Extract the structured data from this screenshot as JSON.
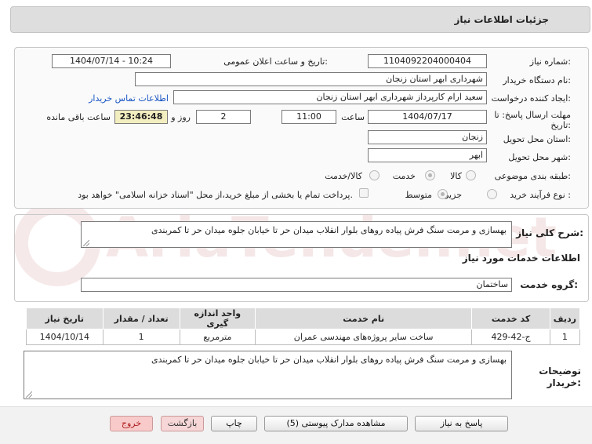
{
  "header": {
    "title": "جزئیات اطلاعات نیاز"
  },
  "fields": {
    "need_number": {
      "label": "شماره نیاز:",
      "value": "1104092204000404"
    },
    "announce_datetime": {
      "label": "تاریخ و ساعت اعلان عمومی:",
      "value": "1404/07/14 - 10:24"
    },
    "buyer_org": {
      "label": "نام دستگاه خریدار:",
      "value": "شهرداری ابهر استان زنجان"
    },
    "creator": {
      "label": "ایجاد کننده درخواست:",
      "value": "سعید ارام کارپرداز  شهرداری ابهر استان زنجان"
    },
    "contact_link": "اطلاعات تماس خریدار",
    "deadline": {
      "label": "مهلت ارسال پاسخ: تا تاریخ:",
      "date": "1404/07/17",
      "time_label": "ساعت",
      "time": "11:00",
      "days": "2",
      "days_label": "روز و",
      "remaining": "23:46:48",
      "remaining_label": "ساعت باقی مانده"
    },
    "province": {
      "label": "استان محل تحویل:",
      "value": "زنجان"
    },
    "city": {
      "label": "شهر محل تحویل:",
      "value": "ابهر"
    },
    "category": {
      "label": "طبقه بندی موضوعی:",
      "options": [
        "کالا",
        "خدمت",
        "کالا/خدمت"
      ],
      "selected": "خدمت"
    },
    "process_type": {
      "label": "نوع فرآیند خرید :",
      "options": [
        "جزیی",
        "متوسط"
      ],
      "selected": "متوسط",
      "payment_note": "پرداخت تمام یا بخشی از مبلغ خرید،از محل \"اسناد خزانه اسلامی\" خواهد بود."
    }
  },
  "description": {
    "label": "شرح کلی نیاز:",
    "value": "بهسازی و مرمت سنگ فرش پیاده روهای بلوار انقلاب میدان حر تا خیابان جلوه میدان حر تا کمربندی"
  },
  "services": {
    "section_title": "اطلاعات خدمات مورد نیاز",
    "group_label": "گروه خدمت:",
    "group_value": "ساختمان",
    "table": {
      "headers": [
        "ردیف",
        "کد خدمت",
        "نام خدمت",
        "واحد اندازه گیری",
        "تعداد / مقدار",
        "تاریخ نیاز"
      ],
      "rows": [
        [
          "1",
          "ج-42-429",
          "ساخت سایر پروژه‌های مهندسی عمران",
          "مترمربع",
          "1",
          "1404/10/14"
        ]
      ]
    }
  },
  "buyer_notes": {
    "label": "توضیحات خریدار:",
    "value": "بهسازی و مرمت سنگ فرش پیاده روهای بلوار انقلاب میدان حر تا خیابان جلوه میدان حر تا کمربندی"
  },
  "buttons": {
    "reply": "پاسخ به نیاز",
    "attachments": "مشاهده مدارک پیوستی (5)",
    "print": "چاپ",
    "back": "بازگشت",
    "exit": "خروج"
  },
  "watermark": "AriaTender.net",
  "colors": {
    "header_bg": "#dedede",
    "link": "#1a56c4",
    "remaining_bg": "#f3eec0",
    "exit_text": "#b02020"
  }
}
